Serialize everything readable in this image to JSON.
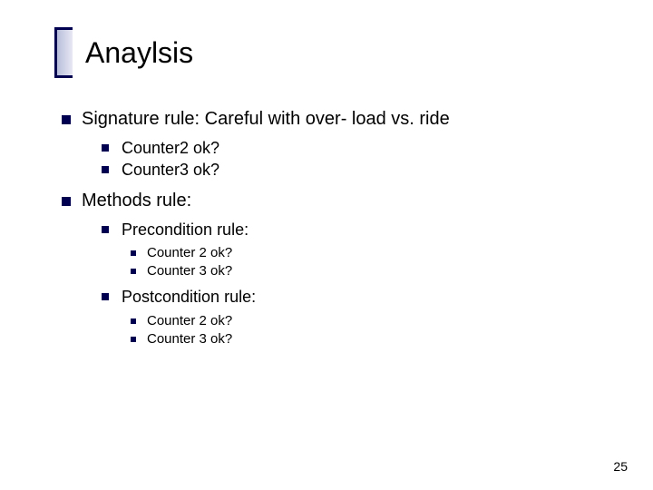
{
  "title": "Anaylsis",
  "page_number": "25",
  "bullets": {
    "sig_rule": "Signature rule: Careful with over- load vs. ride",
    "sig_c2": "Counter2 ok?",
    "sig_c3": "Counter3 ok?",
    "methods_rule": "Methods rule:",
    "precond": "Precondition rule:",
    "pre_c2": "Counter 2 ok?",
    "pre_c3": "Counter 3 ok?",
    "postcond": "Postcondition rule:",
    "post_c2": "Counter 2 ok?",
    "post_c3": "Counter 3 ok?"
  }
}
